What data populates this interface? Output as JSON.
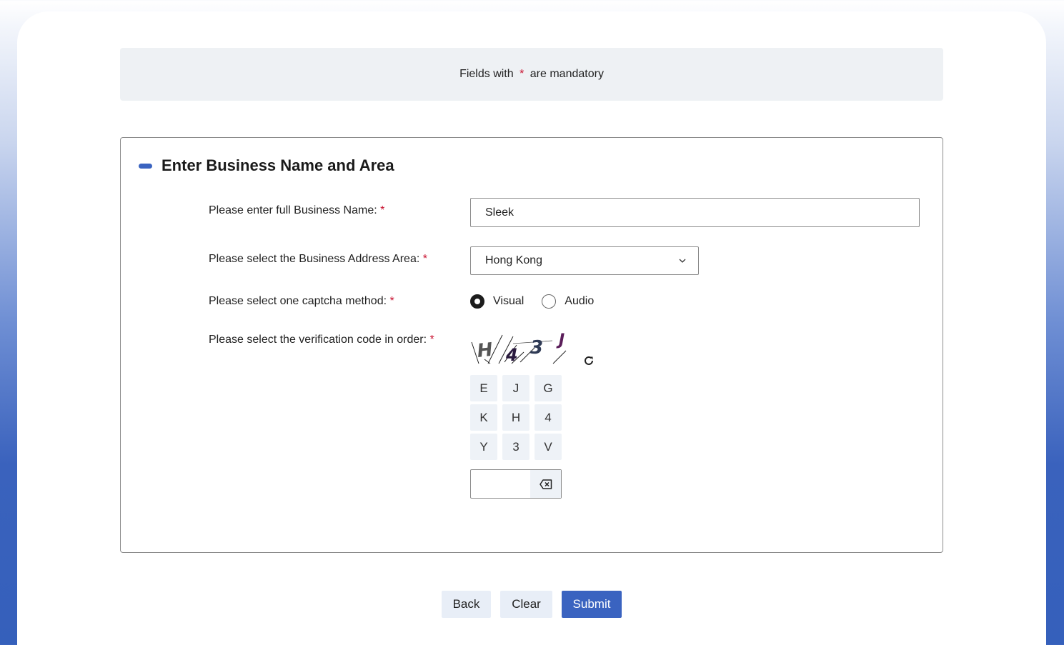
{
  "notice": {
    "prefix": "Fields with ",
    "asterisk": "*",
    "suffix": " are mandatory"
  },
  "section": {
    "title": "Enter Business Name and Area",
    "business_name": {
      "label": "Please enter full Business Name:",
      "value": "Sleek"
    },
    "address_area": {
      "label": "Please select the Business Address Area:",
      "selected": "Hong Kong"
    },
    "captcha_method": {
      "label": "Please select one captcha method:",
      "options": [
        "Visual",
        "Audio"
      ],
      "selected": "Visual"
    },
    "verification": {
      "label": "Please select the verification code in order:",
      "captcha_chars": [
        "H",
        "4",
        "3",
        "J"
      ],
      "keypad": [
        "E",
        "J",
        "G",
        "K",
        "H",
        "4",
        "Y",
        "3",
        "V"
      ],
      "input_value": ""
    },
    "required_mark": "*"
  },
  "buttons": {
    "back": "Back",
    "clear": "Clear",
    "submit": "Submit"
  },
  "colors": {
    "accent": "#3a63c0",
    "required": "#c8102e",
    "notice_bg": "#eef1f4",
    "key_bg": "#eef2f7"
  },
  "icons": [
    "collapse-icon",
    "chevron-down-icon",
    "refresh-icon",
    "backspace-icon"
  ]
}
